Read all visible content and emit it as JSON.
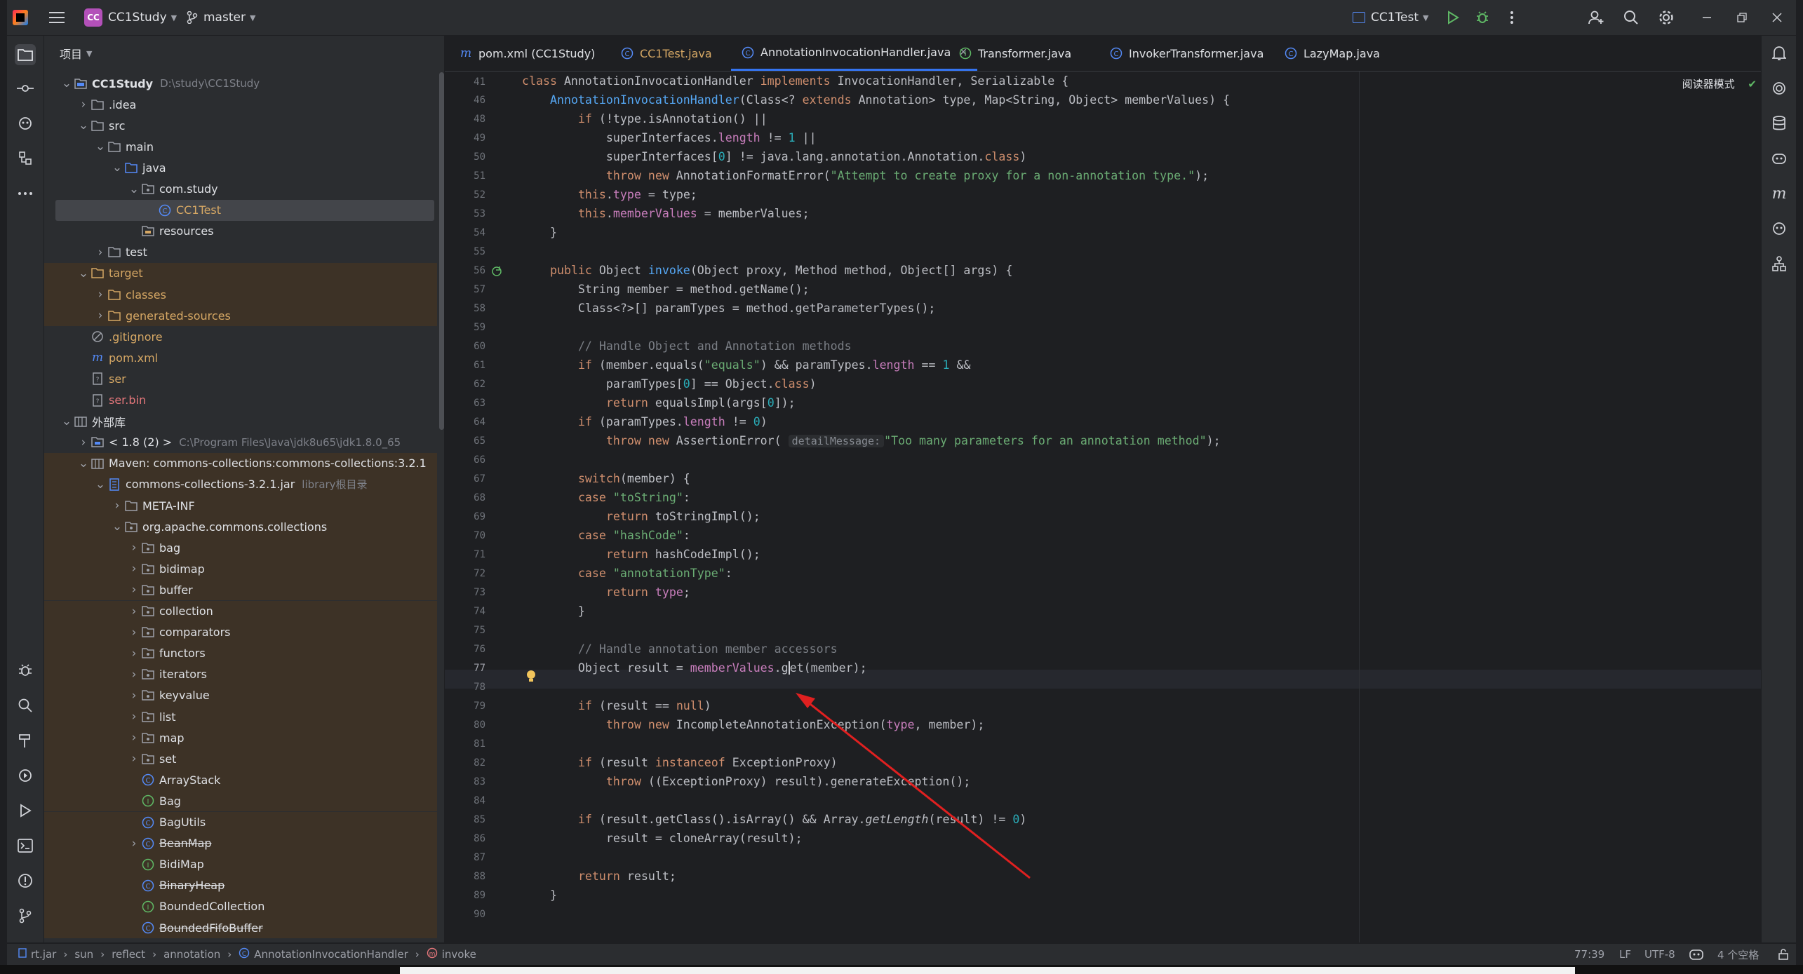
{
  "titlebar": {
    "project_badge": "CC",
    "project_name": "CC1Study",
    "branch": "master",
    "run_config": "CC1Test"
  },
  "project_panel": {
    "title": "项目",
    "tree": [
      {
        "label": "CC1Study",
        "sub": "D:\\study\\CC1Study"
      },
      {
        "label": ".idea"
      },
      {
        "label": "src"
      },
      {
        "label": "main"
      },
      {
        "label": "java"
      },
      {
        "label": "com.study"
      },
      {
        "label": "CC1Test"
      },
      {
        "label": "resources"
      },
      {
        "label": "test"
      },
      {
        "label": "target"
      },
      {
        "label": "classes"
      },
      {
        "label": "generated-sources"
      },
      {
        "label": ".gitignore"
      },
      {
        "label": "pom.xml"
      },
      {
        "label": "ser"
      },
      {
        "label": "ser.bin"
      },
      {
        "label": "外部库"
      },
      {
        "label": "< 1.8 (2) >",
        "sub": "C:\\Program Files\\Java\\jdk8u65\\jdk1.8.0_65"
      },
      {
        "label": "Maven: commons-collections:commons-collections:3.2.1"
      },
      {
        "label": "commons-collections-3.2.1.jar",
        "sub": "library根目录"
      },
      {
        "label": "META-INF"
      },
      {
        "label": "org.apache.commons.collections"
      },
      {
        "label": "bag"
      },
      {
        "label": "bidimap"
      },
      {
        "label": "buffer"
      },
      {
        "label": "collection"
      },
      {
        "label": "comparators"
      },
      {
        "label": "functors"
      },
      {
        "label": "iterators"
      },
      {
        "label": "keyvalue"
      },
      {
        "label": "list"
      },
      {
        "label": "map"
      },
      {
        "label": "set"
      },
      {
        "label": "ArrayStack"
      },
      {
        "label": "Bag"
      },
      {
        "label": "BagUtils"
      },
      {
        "label": "BeanMap"
      },
      {
        "label": "BidiMap"
      },
      {
        "label": "BinaryHeap"
      },
      {
        "label": "BoundedCollection"
      },
      {
        "label": "BoundedFifoBuffer"
      }
    ]
  },
  "tabs": [
    {
      "label": "pom.xml (CC1Study)"
    },
    {
      "label": "CC1Test.java"
    },
    {
      "label": "AnnotationInvocationHandler.java"
    },
    {
      "label": "Transformer.java"
    },
    {
      "label": "InvokerTransformer.java"
    },
    {
      "label": "LazyMap.java"
    }
  ],
  "editor": {
    "reader_mode": "阅读器模式",
    "line_numbers": [
      "41",
      "46",
      "48",
      "49",
      "50",
      "51",
      "52",
      "53",
      "54",
      "55",
      "56",
      "57",
      "58",
      "59",
      "60",
      "61",
      "62",
      "63",
      "64",
      "65",
      "66",
      "67",
      "68",
      "69",
      "70",
      "71",
      "72",
      "73",
      "74",
      "75",
      "76",
      "77",
      "78",
      "79",
      "80",
      "81",
      "82",
      "83",
      "84",
      "85",
      "86",
      "87",
      "88",
      "89",
      "90"
    ],
    "hint": "detailMessage:"
  },
  "statusbar": {
    "breadcrumb": [
      "rt.jar",
      "sun",
      "reflect",
      "annotation",
      "AnnotationInvocationHandler",
      "invoke"
    ],
    "position": "77:39",
    "line_sep": "LF",
    "encoding": "UTF-8",
    "indent": "4 个空格"
  },
  "colors": {
    "accent": "#3574f0",
    "keyword": "#cf8e6d",
    "string": "#6aab73",
    "field": "#c77dbb",
    "annotation_arrow": "#e02020"
  }
}
